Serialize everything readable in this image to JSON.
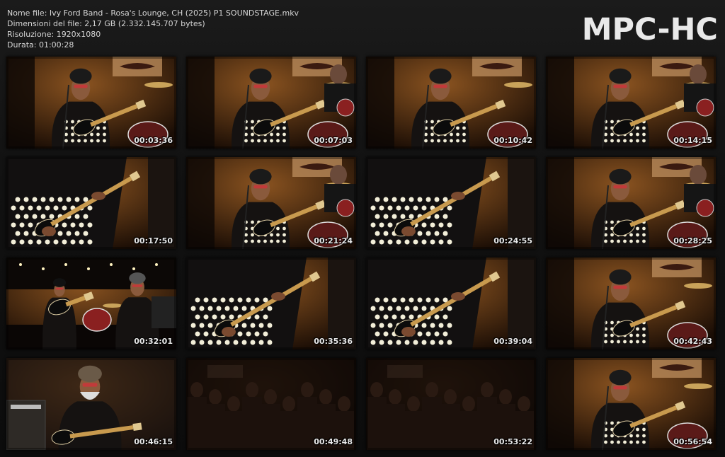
{
  "file_info": {
    "name": "Nome file: Ivy Ford Band - Rosa's Lounge, CH (2025) P1 SOUNDSTAGE.mkv",
    "size": "Dimensioni del file: 2,17 GB (2.332.145.707 bytes)",
    "resolution": "Risoluzione: 1920x1080",
    "duration": "Durata: 01:00:28"
  },
  "brand": "MPC-HC",
  "thumbnails": [
    {
      "time": "00:03:36",
      "scene": "singer-wide"
    },
    {
      "time": "00:07:03",
      "scene": "singer-drummer"
    },
    {
      "time": "00:10:42",
      "scene": "singer-wide"
    },
    {
      "time": "00:14:15",
      "scene": "singer-drummer"
    },
    {
      "time": "00:17:50",
      "scene": "guitar-closeup"
    },
    {
      "time": "00:21:24",
      "scene": "singer-drummer"
    },
    {
      "time": "00:24:55",
      "scene": "guitar-closeup"
    },
    {
      "time": "00:28:25",
      "scene": "singer-drummer"
    },
    {
      "time": "00:32:01",
      "scene": "band-wide"
    },
    {
      "time": "00:35:36",
      "scene": "guitar-closeup"
    },
    {
      "time": "00:39:04",
      "scene": "guitar-closeup"
    },
    {
      "time": "00:42:43",
      "scene": "singer-wide"
    },
    {
      "time": "00:46:15",
      "scene": "bassist"
    },
    {
      "time": "00:49:48",
      "scene": "crowd-dark"
    },
    {
      "time": "00:53:22",
      "scene": "crowd-dark"
    },
    {
      "time": "00:56:54",
      "scene": "singer-wide"
    }
  ],
  "colors": {
    "background": "#141414",
    "text": "#d6d6d6",
    "brand": "#e9e9e9",
    "stage_warm": "#6b3a16",
    "shadow": "#120905"
  }
}
